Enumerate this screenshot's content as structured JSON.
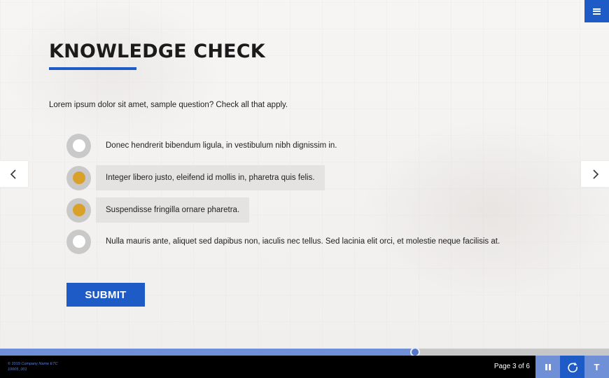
{
  "header": {
    "menu_icon": "hamburger-menu-icon",
    "title": "KNOWLEDGE CHECK"
  },
  "quiz": {
    "question": "Lorem ipsum dolor sit amet, sample question? Check all that apply.",
    "options": [
      {
        "label": "Donec hendrerit bibendum ligula, in vestibulum nibh dignissim in.",
        "selected": false
      },
      {
        "label": "Integer libero justo, eleifend id mollis in, pharetra quis felis.",
        "selected": true
      },
      {
        "label": "Suspendisse fringilla ornare pharetra.",
        "selected": true
      },
      {
        "label": "Nulla mauris ante, aliquet sed dapibus non, iaculis nec tellus. Sed lacinia elit orci, et molestie neque facilisis at.",
        "selected": false
      }
    ],
    "submit_label": "SUBMIT"
  },
  "navigation": {
    "prev_icon": "chevron-left-icon",
    "next_icon": "chevron-right-icon"
  },
  "progress": {
    "fraction": 0.682
  },
  "footer": {
    "copyright_prefix": "© 2019",
    "company": "Company Name ETC",
    "code": "10005_001",
    "page_label": "Page 3 of 6",
    "pause_icon": "pause-icon",
    "replay_icon": "replay-icon",
    "text_toggle_label": "T"
  },
  "colors": {
    "accent": "#1f5bc7",
    "accent_light": "#6f8fd6",
    "selected_dot": "#d9a02a",
    "footer_bg": "#000000"
  }
}
